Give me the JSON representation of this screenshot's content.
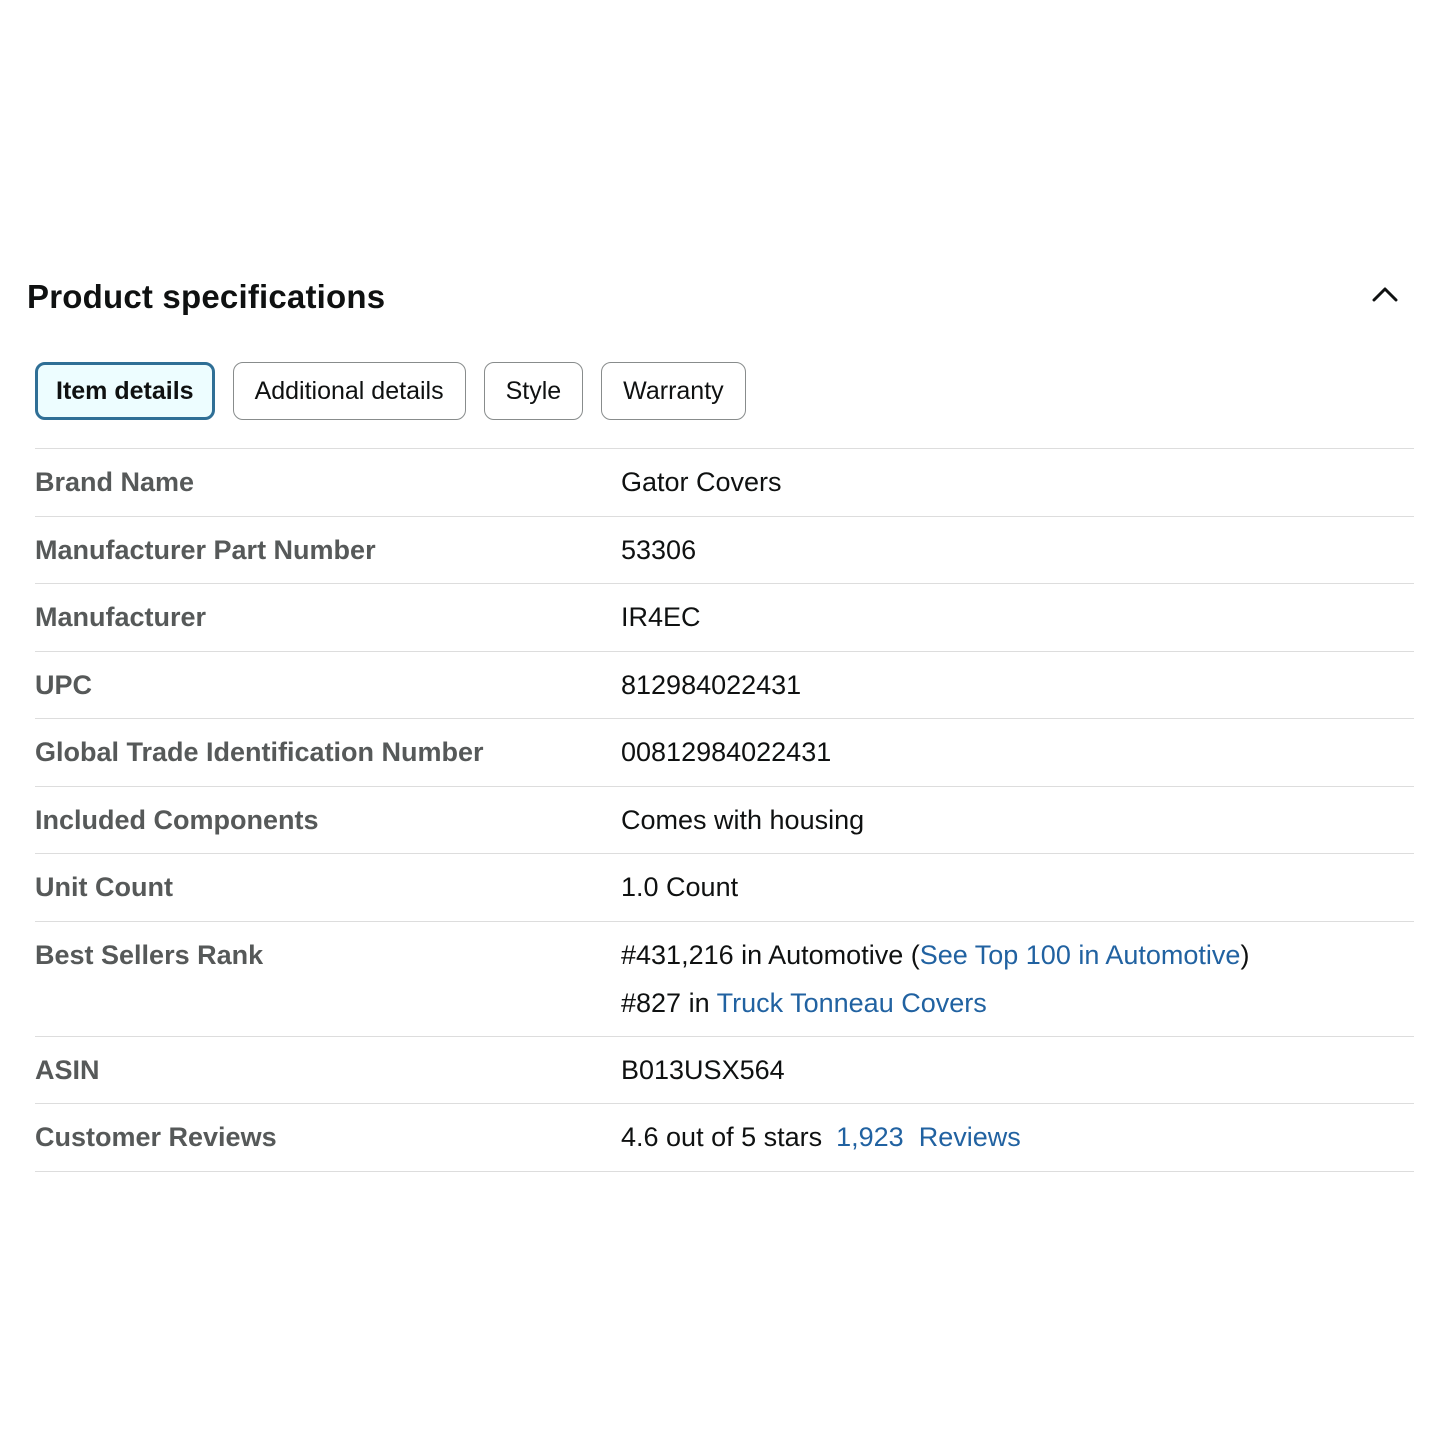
{
  "section": {
    "title": "Product specifications"
  },
  "tabs": [
    {
      "label": "Item details",
      "active": true
    },
    {
      "label": "Additional details",
      "active": false
    },
    {
      "label": "Style",
      "active": false
    },
    {
      "label": "Warranty",
      "active": false
    }
  ],
  "rows": {
    "brand_name": {
      "key": "Brand Name",
      "value": "Gator Covers"
    },
    "mfr_part_number": {
      "key": "Manufacturer Part Number",
      "value": "53306"
    },
    "manufacturer": {
      "key": "Manufacturer",
      "value": "IR4EC"
    },
    "upc": {
      "key": "UPC",
      "value": "812984022431"
    },
    "gtin": {
      "key": "Global Trade Identification Number",
      "value": "00812984022431"
    },
    "included_components": {
      "key": "Included Components",
      "value": "Comes with housing"
    },
    "unit_count": {
      "key": "Unit Count",
      "value": "1.0 Count"
    },
    "best_sellers_rank": {
      "key": "Best Sellers Rank",
      "line1_prefix": "#431,216 in Automotive (",
      "line1_link": "See Top 100 in Automotive",
      "line1_suffix": ")",
      "line2_prefix": "#827 in ",
      "line2_link": "Truck Tonneau Covers"
    },
    "asin": {
      "key": "ASIN",
      "value": "B013USX564"
    },
    "customer_reviews": {
      "key": "Customer Reviews",
      "rating_text": "4.6 out of 5 stars",
      "review_count": "1,923",
      "reviews_label": "Reviews"
    }
  },
  "colors": {
    "link": "#2162a1",
    "active_tab_border": "#2f6f96",
    "active_tab_bg": "#edfdff",
    "key_text": "#565959",
    "divider": "#dddddd"
  },
  "icons": {
    "collapse": "chevron-up-icon"
  }
}
